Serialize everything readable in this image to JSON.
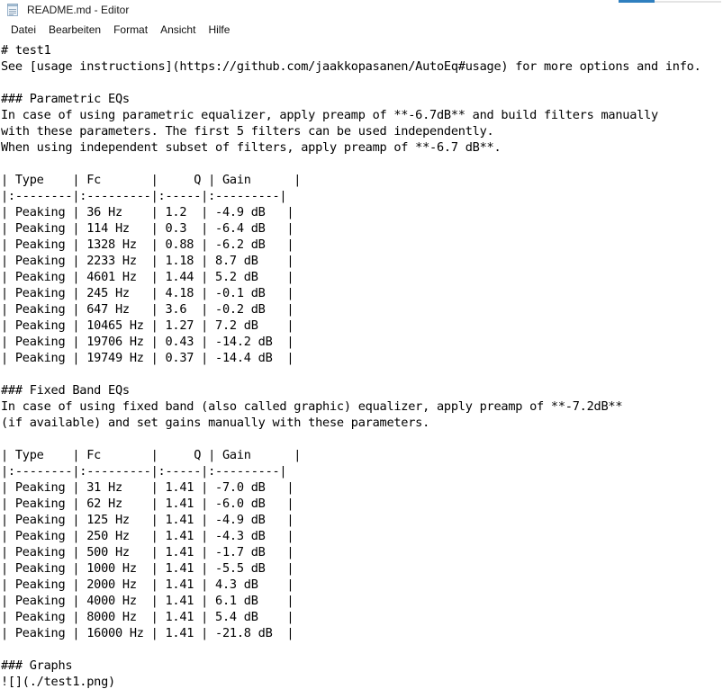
{
  "window": {
    "title": "README.md - Editor",
    "icon": "notepad-icon",
    "accent_color": "#2f7fbf",
    "background_color": "#ffffff",
    "text_color": "#000000"
  },
  "menubar": {
    "items": [
      {
        "label": "Datei"
      },
      {
        "label": "Bearbeiten"
      },
      {
        "label": "Format"
      },
      {
        "label": "Ansicht"
      },
      {
        "label": "Hilfe"
      }
    ]
  },
  "document": {
    "filename": "README.md",
    "heading_h1": "# test1",
    "usage_line": "See [usage instructions](https://github.com/jaakkopasanen/AutoEq#usage) for more options and info.",
    "parametric": {
      "heading": "### Parametric EQs",
      "description_lines": [
        "In case of using parametric equalizer, apply preamp of **-6.7dB** and build filters manually",
        "with these parameters. The first 5 filters can be used independently.",
        "When using independent subset of filters, apply preamp of **-6.7 dB**."
      ],
      "preamp": "-6.7dB",
      "independent_preamp": "-6.7 dB",
      "independent_filter_count": 5,
      "table": {
        "headers": [
          "Type",
          "Fc",
          "Q",
          "Gain"
        ],
        "separator": "|:--------|:---------|:-----|:---------|",
        "rows": [
          {
            "type": "Peaking",
            "fc": "36 Hz",
            "q": "1.2",
            "gain": "-4.9 dB"
          },
          {
            "type": "Peaking",
            "fc": "114 Hz",
            "q": "0.3",
            "gain": "-6.4 dB"
          },
          {
            "type": "Peaking",
            "fc": "1328 Hz",
            "q": "0.88",
            "gain": "-6.2 dB"
          },
          {
            "type": "Peaking",
            "fc": "2233 Hz",
            "q": "1.18",
            "gain": "8.7 dB"
          },
          {
            "type": "Peaking",
            "fc": "4601 Hz",
            "q": "1.44",
            "gain": "5.2 dB"
          },
          {
            "type": "Peaking",
            "fc": "245 Hz",
            "q": "4.18",
            "gain": "-0.1 dB"
          },
          {
            "type": "Peaking",
            "fc": "647 Hz",
            "q": "3.6",
            "gain": "-0.2 dB"
          },
          {
            "type": "Peaking",
            "fc": "10465 Hz",
            "q": "1.27",
            "gain": "7.2 dB"
          },
          {
            "type": "Peaking",
            "fc": "19706 Hz",
            "q": "0.43",
            "gain": "-14.2 dB"
          },
          {
            "type": "Peaking",
            "fc": "19749 Hz",
            "q": "0.37",
            "gain": "-14.4 dB"
          }
        ]
      }
    },
    "fixed_band": {
      "heading": "### Fixed Band EQs",
      "description_lines": [
        "In case of using fixed band (also called graphic) equalizer, apply preamp of **-7.2dB**",
        "(if available) and set gains manually with these parameters."
      ],
      "preamp": "-7.2dB",
      "table": {
        "headers": [
          "Type",
          "Fc",
          "Q",
          "Gain"
        ],
        "separator": "|:--------|:---------|:-----|:---------|",
        "rows": [
          {
            "type": "Peaking",
            "fc": "31 Hz",
            "q": "1.41",
            "gain": "-7.0 dB"
          },
          {
            "type": "Peaking",
            "fc": "62 Hz",
            "q": "1.41",
            "gain": "-6.0 dB"
          },
          {
            "type": "Peaking",
            "fc": "125 Hz",
            "q": "1.41",
            "gain": "-4.9 dB"
          },
          {
            "type": "Peaking",
            "fc": "250 Hz",
            "q": "1.41",
            "gain": "-4.3 dB"
          },
          {
            "type": "Peaking",
            "fc": "500 Hz",
            "q": "1.41",
            "gain": "-1.7 dB"
          },
          {
            "type": "Peaking",
            "fc": "1000 Hz",
            "q": "1.41",
            "gain": "-5.5 dB"
          },
          {
            "type": "Peaking",
            "fc": "2000 Hz",
            "q": "1.41",
            "gain": "4.3 dB"
          },
          {
            "type": "Peaking",
            "fc": "4000 Hz",
            "q": "1.41",
            "gain": "6.1 dB"
          },
          {
            "type": "Peaking",
            "fc": "8000 Hz",
            "q": "1.41",
            "gain": "5.4 dB"
          },
          {
            "type": "Peaking",
            "fc": "16000 Hz",
            "q": "1.41",
            "gain": "-21.8 dB"
          }
        ]
      }
    },
    "graphs": {
      "heading": "### Graphs",
      "image_markdown": "![](./test1.png)"
    },
    "body_text": "# test1\nSee [usage instructions](https://github.com/jaakkopasanen/AutoEq#usage) for more options and info.\n\n### Parametric EQs\nIn case of using parametric equalizer, apply preamp of **-6.7dB** and build filters manually\nwith these parameters. The first 5 filters can be used independently.\nWhen using independent subset of filters, apply preamp of **-6.7 dB**.\n\n| Type    | Fc       |     Q | Gain      |\n|:--------|:---------|:-----|:---------|\n| Peaking | 36 Hz    | 1.2  | -4.9 dB   |\n| Peaking | 114 Hz   | 0.3  | -6.4 dB   |\n| Peaking | 1328 Hz  | 0.88 | -6.2 dB   |\n| Peaking | 2233 Hz  | 1.18 | 8.7 dB    |\n| Peaking | 4601 Hz  | 1.44 | 5.2 dB    |\n| Peaking | 245 Hz   | 4.18 | -0.1 dB   |\n| Peaking | 647 Hz   | 3.6  | -0.2 dB   |\n| Peaking | 10465 Hz | 1.27 | 7.2 dB    |\n| Peaking | 19706 Hz | 0.43 | -14.2 dB  |\n| Peaking | 19749 Hz | 0.37 | -14.4 dB  |\n\n### Fixed Band EQs\nIn case of using fixed band (also called graphic) equalizer, apply preamp of **-7.2dB**\n(if available) and set gains manually with these parameters.\n\n| Type    | Fc       |     Q | Gain      |\n|:--------|:---------|:-----|:---------|\n| Peaking | 31 Hz    | 1.41 | -7.0 dB   |\n| Peaking | 62 Hz    | 1.41 | -6.0 dB   |\n| Peaking | 125 Hz   | 1.41 | -4.9 dB   |\n| Peaking | 250 Hz   | 1.41 | -4.3 dB   |\n| Peaking | 500 Hz   | 1.41 | -1.7 dB   |\n| Peaking | 1000 Hz  | 1.41 | -5.5 dB   |\n| Peaking | 2000 Hz  | 1.41 | 4.3 dB    |\n| Peaking | 4000 Hz  | 1.41 | 6.1 dB    |\n| Peaking | 8000 Hz  | 1.41 | 5.4 dB    |\n| Peaking | 16000 Hz | 1.41 | -21.8 dB  |\n\n### Graphs\n![](./test1.png)"
  }
}
